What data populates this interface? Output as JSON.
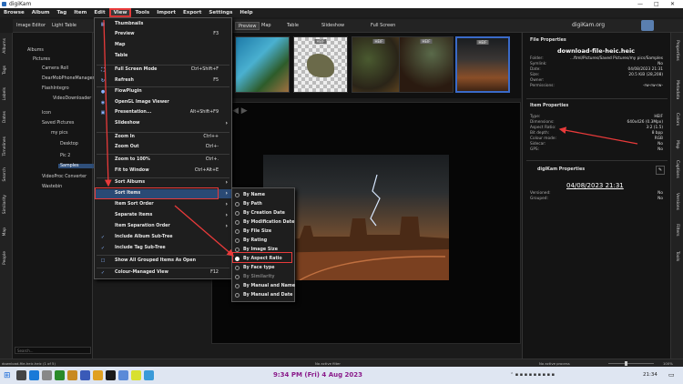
{
  "window": {
    "title": "digiKam"
  },
  "menubar": {
    "items": [
      "Browse",
      "Album",
      "Tag",
      "Item",
      "Edit",
      "View",
      "Tools",
      "Import",
      "Export",
      "Settings",
      "Help"
    ]
  },
  "toolbar": {
    "image_editor": "Image Editor",
    "light_table": "Light Table",
    "preview": "Preview",
    "map": "Map",
    "table": "Table",
    "slideshow": "Slideshow",
    "full_screen": "Full Screen"
  },
  "left_tabs": [
    "Albums",
    "Tags",
    "Labels",
    "Dates",
    "Timelines",
    "Search",
    "Similarity",
    "Map",
    "People"
  ],
  "right_tabs": [
    "Properties",
    "Metadata",
    "Colors",
    "Map",
    "Captions",
    "Versions",
    "Filters",
    "Tools"
  ],
  "albums": {
    "header": "Albums",
    "tree": [
      "Pictures",
      "Camera Roll",
      "DearMobPhoneManager",
      "FlashIntegro",
      "VideoDownloader",
      "Icon",
      "Saved Pictures",
      "my pics",
      "Desktop",
      "Pic 2",
      "Samples",
      "VideoProc Converter",
      "Wastebin"
    ],
    "search_placeholder": "Search..."
  },
  "view_menu": {
    "items": [
      {
        "label": "Thumbnails",
        "shortcut": ""
      },
      {
        "label": "Preview",
        "shortcut": "F3"
      },
      {
        "label": "Map",
        "shortcut": ""
      },
      {
        "label": "Table",
        "shortcut": ""
      },
      {
        "label": "Full Screen Mode",
        "shortcut": "Ctrl+Shift+F"
      },
      {
        "label": "Refresh",
        "shortcut": "F5"
      },
      {
        "label": "FlowPlugin",
        "shortcut": ""
      },
      {
        "label": "OpenGL Image Viewer",
        "shortcut": ""
      },
      {
        "label": "Presentation...",
        "shortcut": "Alt+Shift+F9"
      },
      {
        "label": "Slideshow",
        "shortcut": ""
      },
      {
        "label": "Zoom In",
        "shortcut": "Ctrl++"
      },
      {
        "label": "Zoom Out",
        "shortcut": "Ctrl+-"
      },
      {
        "label": "Zoom to 100%",
        "shortcut": "Ctrl+."
      },
      {
        "label": "Fit to Window",
        "shortcut": "Ctrl+Alt+E"
      },
      {
        "label": "Sort Albums",
        "shortcut": ""
      },
      {
        "label": "Sort Items",
        "shortcut": ""
      },
      {
        "label": "Item Sort Order",
        "shortcut": ""
      },
      {
        "label": "Separate Items",
        "shortcut": ""
      },
      {
        "label": "Item Separation Order",
        "shortcut": ""
      },
      {
        "label": "Include Album Sub-Tree",
        "shortcut": ""
      },
      {
        "label": "Include Tag Sub-Tree",
        "shortcut": ""
      },
      {
        "label": "Show All Grouped Items As Open",
        "shortcut": ""
      },
      {
        "label": "Colour-Managed View",
        "shortcut": "F12"
      }
    ]
  },
  "sort_menu": {
    "items": [
      "By Name",
      "By Path",
      "By Creation Date",
      "By Modification Date",
      "By File Size",
      "By Rating",
      "By Image Size",
      "By Aspect Ratio",
      "By Face type",
      "By Similarity",
      "By Manual and Name",
      "By Manual and Date"
    ],
    "selected": "By Aspect Ratio"
  },
  "file_properties": {
    "header": "File Properties",
    "filename": "download-file-heic.heic",
    "rows": [
      {
        "label": "Folder:",
        "value": "...ftml/Pictures/Saved Pictures/my pics/Samples"
      },
      {
        "label": "Symlink:",
        "value": "No"
      },
      {
        "label": "Date:",
        "value": "04/08/2023 21:31"
      },
      {
        "label": "Size:",
        "value": "20.5 KiB (28,208)"
      },
      {
        "label": "Owner:",
        "value": ""
      },
      {
        "label": "Permissions:",
        "value": "-rw-rw-rw-"
      }
    ]
  },
  "item_properties": {
    "header": "Item Properties",
    "rows": [
      {
        "label": "Type:",
        "value": "HEIF"
      },
      {
        "label": "Dimensions:",
        "value": "640x426 (0.3Mpx)"
      },
      {
        "label": "Aspect Ratio:",
        "value": "3:2 (1.5)"
      },
      {
        "label": "Bit depth:",
        "value": "8 bpp"
      },
      {
        "label": "Colour mode:",
        "value": "RGB"
      },
      {
        "label": "Sidecar:",
        "value": "No"
      },
      {
        "label": "GPS:",
        "value": "No"
      }
    ]
  },
  "digikam_properties": {
    "header": "digiKam Properties",
    "date": "04/08/2023 21:31",
    "rows": [
      {
        "label": "Versioned:",
        "value": "No"
      },
      {
        "label": "Grouped:",
        "value": "No"
      }
    ]
  },
  "right_header": {
    "text": "digiKam.org"
  },
  "status": {
    "left": "download-file-heic.heic (1 of 5)",
    "mid1": "No active filter",
    "mid2": "No active process",
    "zoom": "100%"
  },
  "taskbar": {
    "datetime_banner": "9:34 PM (Fri) 4 Aug 2023",
    "clock": "21:34"
  },
  "colors": {
    "accent_red": "#e83a3a",
    "selection_blue": "#2f4f7a",
    "banner_purple": "#8a1a8a"
  }
}
